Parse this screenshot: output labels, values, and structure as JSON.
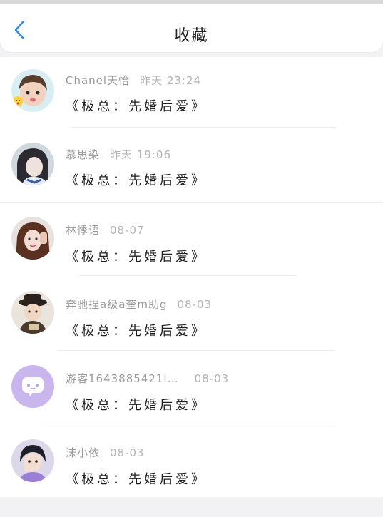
{
  "header": {
    "title": "收藏"
  },
  "items": [
    {
      "name": "Chanel天怡",
      "time": "昨天 23:24",
      "content": "《极总：先婚后爱》"
    },
    {
      "name": "慕思染",
      "time": "昨天 19:06",
      "content": "《极总：先婚后爱》"
    },
    {
      "name": "林悸语",
      "time": "08-07",
      "content": "《极总：先婚后爱》"
    },
    {
      "name": "奔驰捏a级a奎m助g",
      "time": "08-03",
      "content": "《极总：先婚后爱》"
    },
    {
      "name": "游客1643885421l…",
      "time": "08-03",
      "content": "《极总：先婚后爱》"
    },
    {
      "name": "沫小依",
      "time": "08-03",
      "content": "《极总：先婚后爱》"
    }
  ],
  "colors": {
    "accent": "#2f8cf0",
    "guest_avatar": "#c9b6ec"
  }
}
